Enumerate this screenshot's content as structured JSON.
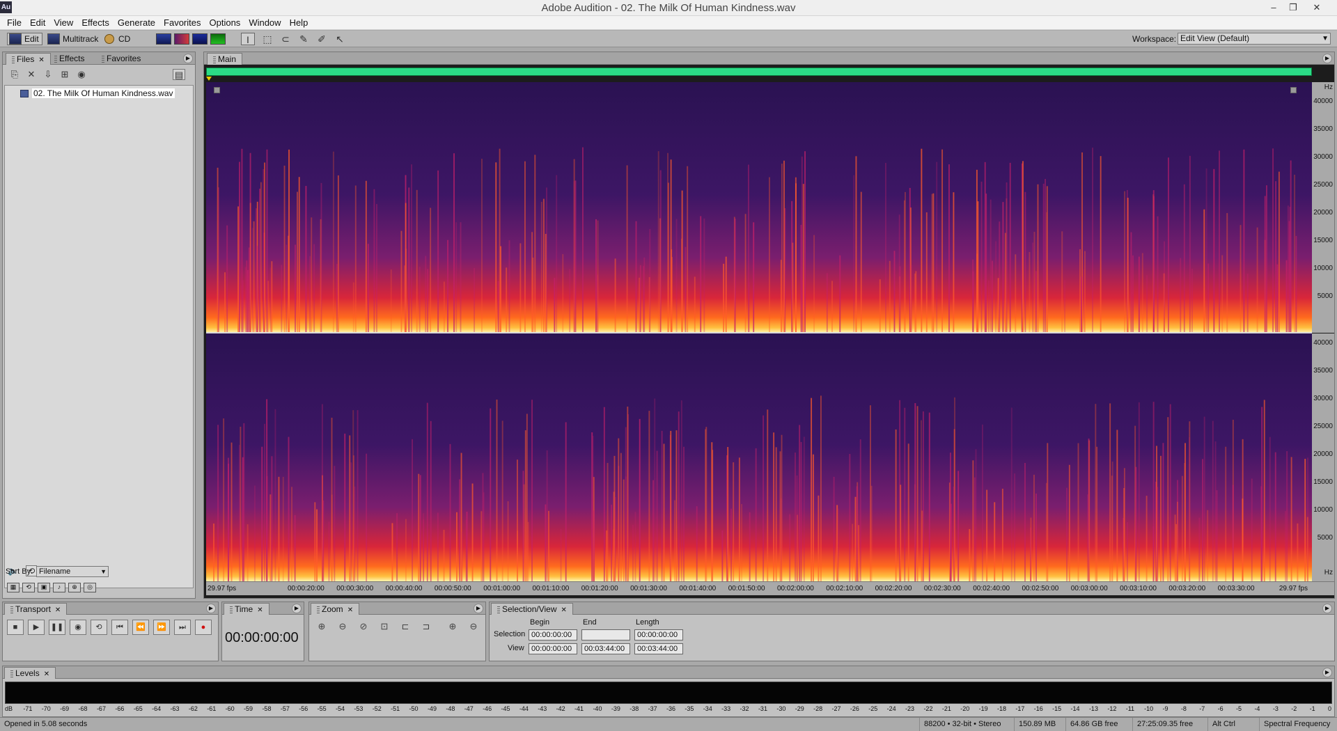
{
  "window": {
    "app_icon": "Au",
    "title": "Adobe Audition - 02. The Milk Of Human Kindness.wav"
  },
  "menu": [
    "File",
    "Edit",
    "View",
    "Effects",
    "Generate",
    "Favorites",
    "Options",
    "Window",
    "Help"
  ],
  "toolbar": {
    "edit_label": "Edit",
    "multitrack_label": "Multitrack",
    "cd_label": "CD",
    "workspace_label": "Workspace:",
    "workspace_value": "Edit View (Default)"
  },
  "files_panel": {
    "tabs": [
      "Files",
      "Effects",
      "Favorites"
    ],
    "file_name": "02. The Milk Of Human Kindness.wav",
    "sort_label": "Sort By:",
    "sort_value": "Filename",
    "counter": "0"
  },
  "main_panel": {
    "tab": "Main",
    "hz_unit": "Hz",
    "hz_ticks_top": [
      "40000",
      "35000",
      "30000",
      "25000",
      "20000",
      "15000",
      "10000",
      "5000"
    ],
    "hz_ticks_bottom": [
      "40000",
      "35000",
      "30000",
      "25000",
      "20000",
      "15000",
      "10000",
      "5000"
    ],
    "fps_left": "29.97 fps",
    "fps_right": "29.97 fps",
    "time_labels": [
      "00:00:20:00",
      "00:00:30:00",
      "00:00:40:00",
      "00:00:50:00",
      "00:01:00:00",
      "00:01:10:00",
      "00:01:20:00",
      "00:01:30:00",
      "00:01:40:00",
      "00:01:50:00",
      "00:02:00:00",
      "00:02:10:00",
      "00:02:20:00",
      "00:02:30:00",
      "00:02:40:00",
      "00:02:50:00",
      "00:03:00:00",
      "00:03:10:00",
      "00:03:20:00",
      "00:03:30:00"
    ],
    "colors": {
      "overview": "#2bdc86",
      "spectrum_low": "#fff7b0",
      "spectrum_mid": "#d8263a",
      "spectrum_high": "#2a1252"
    }
  },
  "transport": {
    "tab": "Transport"
  },
  "time": {
    "tab": "Time",
    "display": "00:00:00:00"
  },
  "zoom": {
    "tab": "Zoom"
  },
  "selection": {
    "tab": "Selection/View",
    "col_begin": "Begin",
    "col_end": "End",
    "col_length": "Length",
    "row_selection": "Selection",
    "row_view": "View",
    "selection_begin": "00:00:00:00",
    "selection_end": "",
    "selection_length": "00:00:00:00",
    "view_begin": "00:00:00:00",
    "view_end": "00:03:44:00",
    "view_length": "00:03:44:00"
  },
  "levels": {
    "tab": "Levels",
    "db_scale": [
      "dB",
      "-71",
      "-70",
      "-69",
      "-68",
      "-67",
      "-66",
      "-65",
      "-64",
      "-63",
      "-62",
      "-61",
      "-60",
      "-59",
      "-58",
      "-57",
      "-56",
      "-55",
      "-54",
      "-53",
      "-52",
      "-51",
      "-50",
      "-49",
      "-48",
      "-47",
      "-46",
      "-45",
      "-44",
      "-43",
      "-42",
      "-41",
      "-40",
      "-39",
      "-38",
      "-37",
      "-36",
      "-35",
      "-34",
      "-33",
      "-32",
      "-31",
      "-30",
      "-29",
      "-28",
      "-27",
      "-26",
      "-25",
      "-24",
      "-23",
      "-22",
      "-21",
      "-20",
      "-19",
      "-18",
      "-17",
      "-16",
      "-15",
      "-14",
      "-13",
      "-12",
      "-11",
      "-10",
      "-9",
      "-8",
      "-7",
      "-6",
      "-5",
      "-4",
      "-3",
      "-2",
      "-1",
      "0"
    ]
  },
  "status": {
    "message": "Opened in 5.08 seconds",
    "format": "88200 • 32-bit • Stereo",
    "size": "150.89 MB",
    "free": "64.86 GB free",
    "free_time": "27:25:09.35 free",
    "keys": "Alt Ctrl",
    "view_mode": "Spectral Frequency"
  }
}
